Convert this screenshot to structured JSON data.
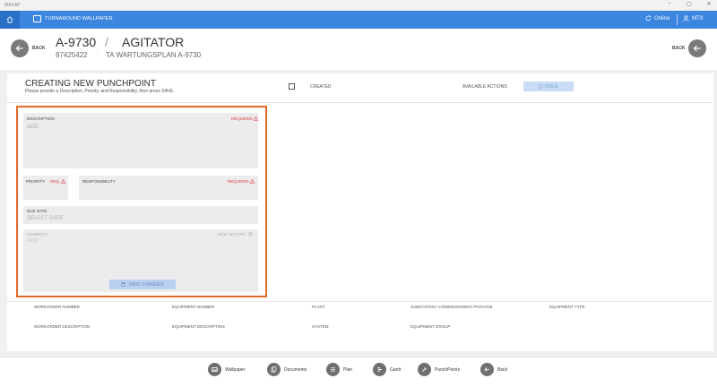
{
  "titlebar": {
    "app_name": "MAXAP",
    "minimize": "–",
    "maximize": "▢",
    "close": "✕"
  },
  "topbar": {
    "title": "TURNAROUND WALLPAPER",
    "online_label": "Online",
    "user_label": "MTX"
  },
  "header": {
    "back_label": "BACK",
    "right_back_label": "BACK",
    "equipment_id": "A-9730",
    "separator": "/",
    "equipment_name": "AGITATOR",
    "order_number": "87425422",
    "dot": "·",
    "plan_name": "TA WARTUNGSPLAN A-9730"
  },
  "punchpoint": {
    "title": "CREATING NEW PUNCHPOINT",
    "subtitle": "Please provide a Description, Priority, and Responsibility, then press SAVE.",
    "created_label": "CREATED",
    "available_actions_label": "AVAILABLE ACTIONS:",
    "issue_label": "ISSUE"
  },
  "form": {
    "description_label": "DESCRIPTION",
    "description_required": "REQUIRED",
    "description_placeholder": "ADD",
    "priority_label": "PRIORITY",
    "priority_required": "REQ.",
    "responsibility_label": "RESPONSIBILITY",
    "responsibility_required": "REQUIRED",
    "due_date_label": "DUE DATE",
    "due_date_placeholder": "SELECT DATE",
    "comment_label": "COMMENT",
    "comment_placeholder": "ADD",
    "view_history_label": "VIEW HISTORY",
    "save_label": "SAVE CHANGES"
  },
  "info": {
    "workorder_number": "WORKORDER NUMBER",
    "equipment_number": "EQUIPMENT NUMBER",
    "plant": "PLANT",
    "subsystem": "SUBSYSTEM / COMMISSIONING PACKAGE",
    "equipment_type": "EQUIPMENT TYPE",
    "workorder_description": "WORKORDER DESCRIPTION",
    "equipment_description": "EQUIPMENT DESCRIPTION",
    "system": "SYSTEM",
    "equipment_group": "EQUIPMENT GROUP"
  },
  "nav": {
    "items": [
      {
        "label": "Wallpaper",
        "icon": "wallpaper-icon"
      },
      {
        "label": "Documents",
        "icon": "documents-icon"
      },
      {
        "label": "Plan",
        "icon": "plan-icon"
      },
      {
        "label": "Gantt",
        "icon": "gantt-icon"
      },
      {
        "label": "PunchPoints",
        "icon": "punchpoints-icon"
      },
      {
        "label": "Back",
        "icon": "back-arrow-icon"
      }
    ]
  },
  "colors": {
    "accent": "#3d86e0",
    "highlight_border": "#e36a2a",
    "required": "#e03a3a"
  }
}
